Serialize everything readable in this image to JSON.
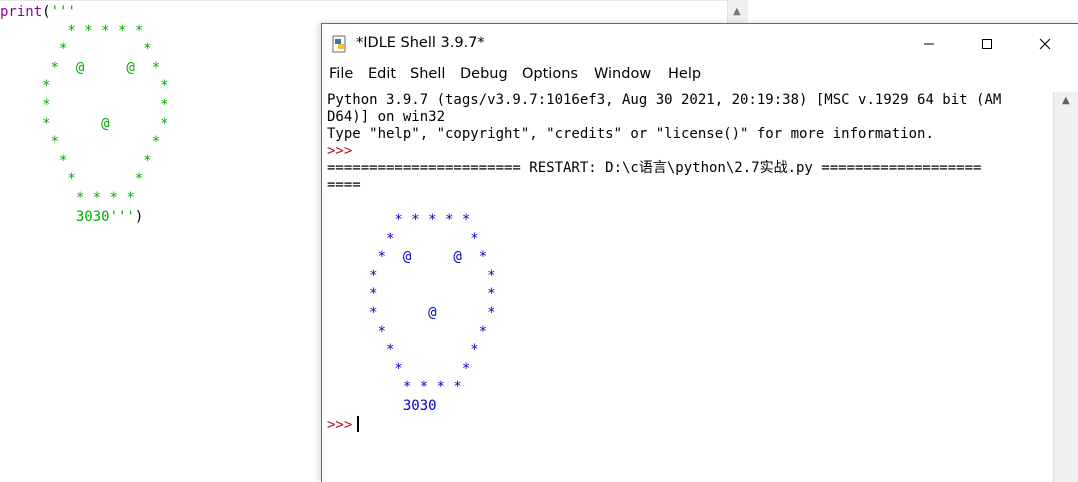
{
  "editor": {
    "code_print": "print",
    "code_paren_open": "(",
    "code_quote_open": "'''",
    "code_lines": [
      "        * * * * *",
      "       *         *",
      "      *  @     @  *",
      "     *             *",
      "     *             *",
      "     *      @      *",
      "      *           *",
      "       *         *",
      "        *       *",
      "         * * * *",
      "         3030'''"
    ],
    "code_paren_close": ")"
  },
  "shell": {
    "title": "*IDLE Shell 3.9.7*",
    "menu": [
      "File",
      "Edit",
      "Shell",
      "Debug",
      "Options",
      "Window",
      "Help"
    ],
    "banner_line1": "Python 3.9.7 (tags/v3.9.7:1016ef3, Aug 30 2021, 20:19:38) [MSC v.1929 64 bit (AM",
    "banner_line2": "D64)] on win32",
    "banner_line3": "Type \"help\", \"copyright\", \"credits\" or \"license()\" for more information.",
    "prompt": ">>>",
    "restart_line1": "======================= RESTART: D:\\c语言\\python\\2.7实战.py ===================",
    "restart_line2": "====",
    "output_lines": [
      "        * * * * *",
      "       *         *",
      "      *  @     @  *",
      "     *             *",
      "     *             *",
      "     *      @      *",
      "      *           *",
      "       *         *",
      "        *       *",
      "         * * * *",
      "         3030"
    ],
    "colors": {
      "string_green": "#00aa00",
      "keyword_purple": "#900090",
      "output_blue": "#0000cc",
      "prompt_red": "#b01020"
    },
    "icons": {
      "minimize": "minimize-icon",
      "maximize": "maximize-icon",
      "close": "close-icon"
    }
  }
}
